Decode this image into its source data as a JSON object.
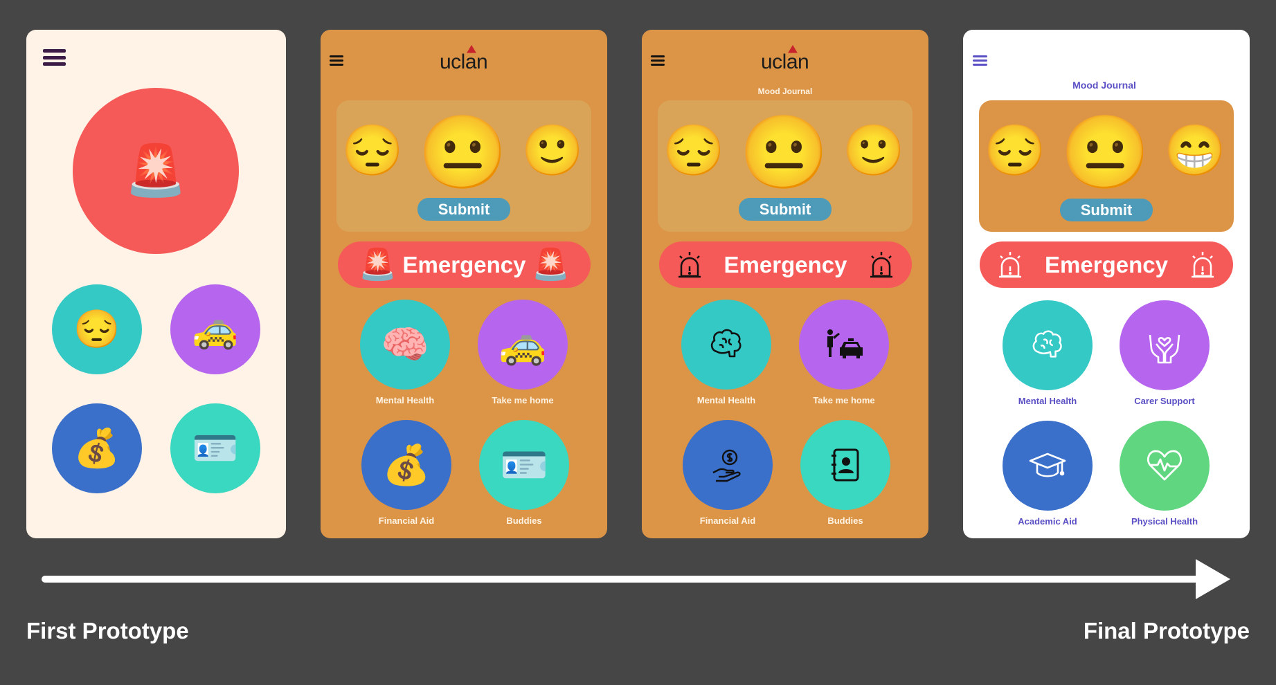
{
  "colors": {
    "background": "#464646",
    "emergency_red": "#f65a58",
    "teal": "#35c9c6",
    "purple": "#b666ee",
    "blue": "#3a6fca",
    "green": "#3ad8c0",
    "physical_green": "#5fd67f",
    "submit_blue": "#4d9bb8",
    "orange_panel": "#dc9446",
    "final_accent": "#5a4fc4"
  },
  "prototypes": [
    {
      "stage": "first",
      "buttons": [
        {
          "icon": "police-light-icon",
          "glyph": "🚨"
        },
        {
          "icon": "pensive-face-icon",
          "glyph": "😔"
        },
        {
          "icon": "taxi-icon",
          "glyph": "🚕"
        },
        {
          "icon": "money-bag-icon",
          "glyph": "💰"
        },
        {
          "icon": "id-card-printer-icon",
          "glyph": "🪪"
        }
      ]
    },
    {
      "stage": "second",
      "logo": "uclan",
      "faces": [
        "😔",
        "😐",
        "🙂"
      ],
      "submit": "Submit",
      "emergency": "Emergency",
      "emergency_glyph": "🚨",
      "tiles": [
        {
          "label": "Mental Health",
          "glyph": "🧠"
        },
        {
          "label": "Take me home",
          "glyph": "🚕"
        },
        {
          "label": "Financial Aid",
          "glyph": "💰"
        },
        {
          "label": "Buddies",
          "glyph": "🪪"
        }
      ]
    },
    {
      "stage": "third",
      "logo": "uclan",
      "journal": "Mood Journal",
      "faces": [
        "😔",
        "😐",
        "🙂"
      ],
      "submit": "Submit",
      "emergency": "Emergency",
      "tiles": [
        {
          "label": "Mental Health",
          "icon": "brain-outline-icon"
        },
        {
          "label": "Take me home",
          "icon": "person-taxi-icon"
        },
        {
          "label": "Financial Aid",
          "icon": "hand-coin-icon"
        },
        {
          "label": "Buddies",
          "icon": "contact-book-icon"
        }
      ]
    },
    {
      "stage": "final",
      "journal": "Mood Journal",
      "faces": [
        "😔",
        "😐",
        "😁"
      ],
      "submit": "Submit",
      "emergency": "Emergency",
      "tiles": [
        {
          "label": "Mental Health",
          "icon": "brain-outline-icon"
        },
        {
          "label": "Carer Support",
          "icon": "hands-heart-icon"
        },
        {
          "label": "Academic Aid",
          "icon": "graduation-cap-icon"
        },
        {
          "label": "Physical Health",
          "icon": "heart-pulse-icon"
        }
      ]
    }
  ],
  "timeline": {
    "start_label": "First Prototype",
    "end_label": "Final Prototype"
  }
}
